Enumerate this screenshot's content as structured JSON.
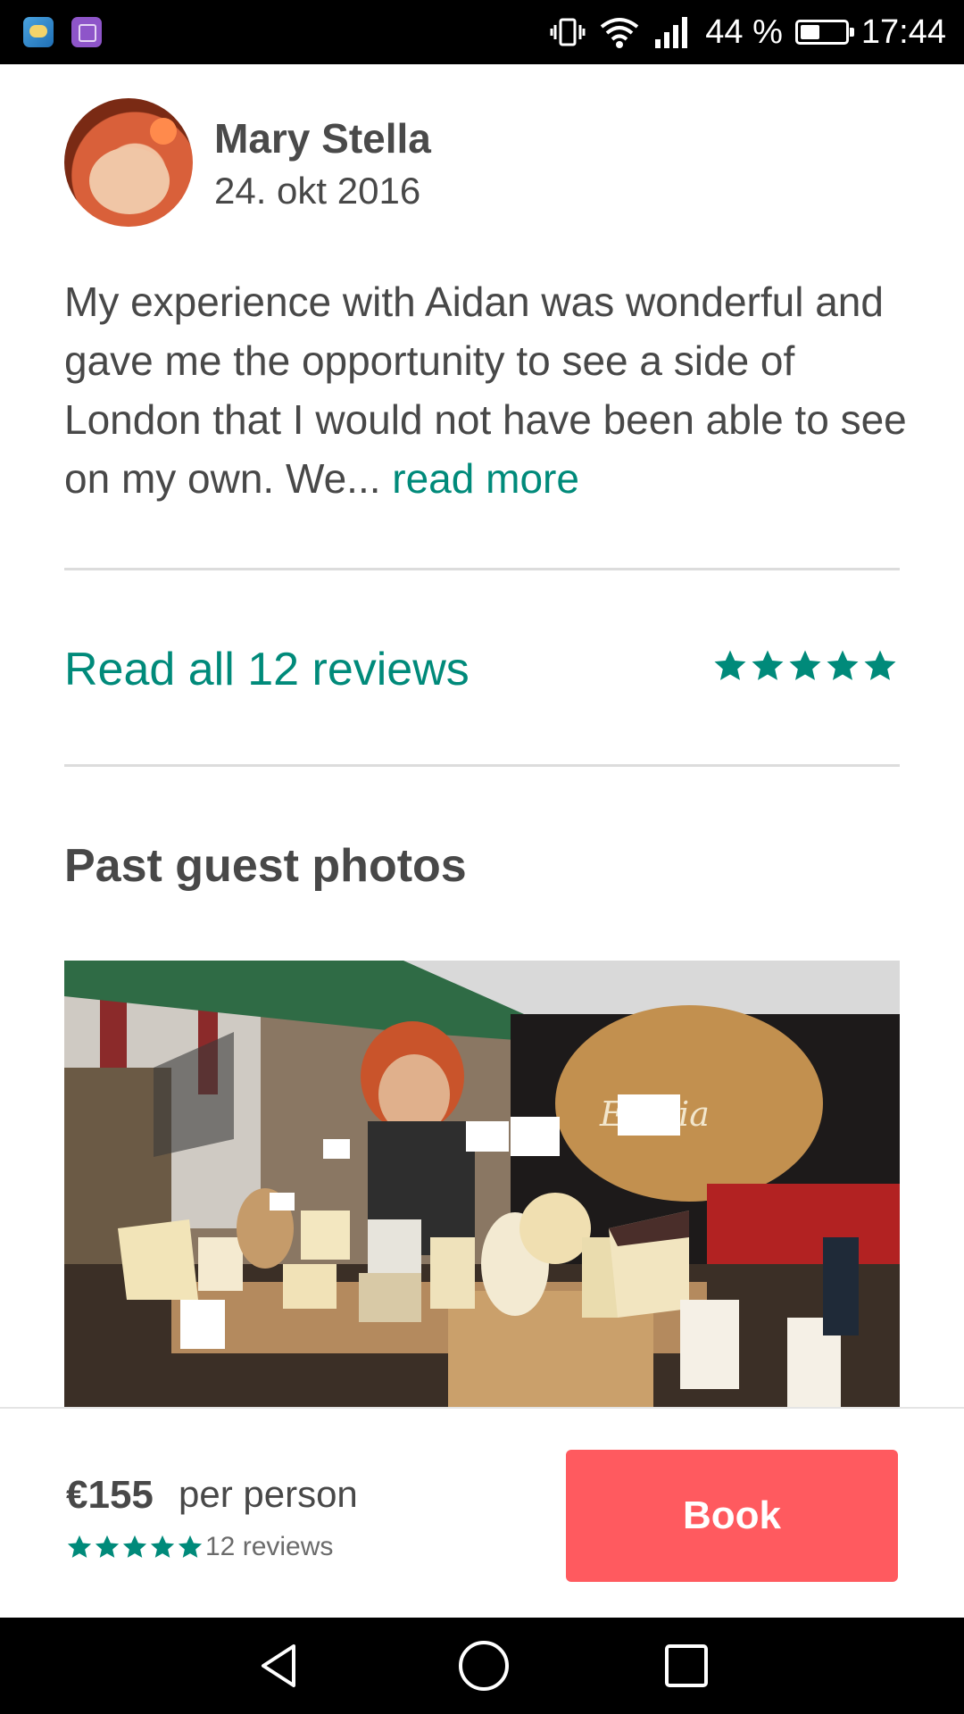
{
  "status_bar": {
    "battery_percent_label": "44 %",
    "battery_level": 0.44,
    "time": "17:44"
  },
  "review": {
    "reviewer_name": "Mary Stella",
    "date": "24. okt 2016",
    "text": "My experience with Aidan was wonderful and gave me the opportunity to see a side of London that I would not have been able to see on my own. We... ",
    "read_more_label": "read more"
  },
  "reviews_summary": {
    "read_all_label": "Read all 12 reviews",
    "rating_stars": 5
  },
  "past_photos": {
    "title": "Past guest photos"
  },
  "booking": {
    "price": "€155",
    "per_person_label": "per person",
    "rating_stars": 5,
    "reviews_label": "12 reviews",
    "book_label": "Book"
  },
  "colors": {
    "accent_teal": "#008a7a",
    "book_button": "#ff5a5f"
  },
  "icons": [
    "weather-app-icon",
    "gallery-app-icon",
    "vibrate-icon",
    "wifi-icon",
    "signal-icon",
    "battery-icon",
    "star-icon",
    "back-nav-icon",
    "home-nav-icon",
    "recents-nav-icon"
  ]
}
